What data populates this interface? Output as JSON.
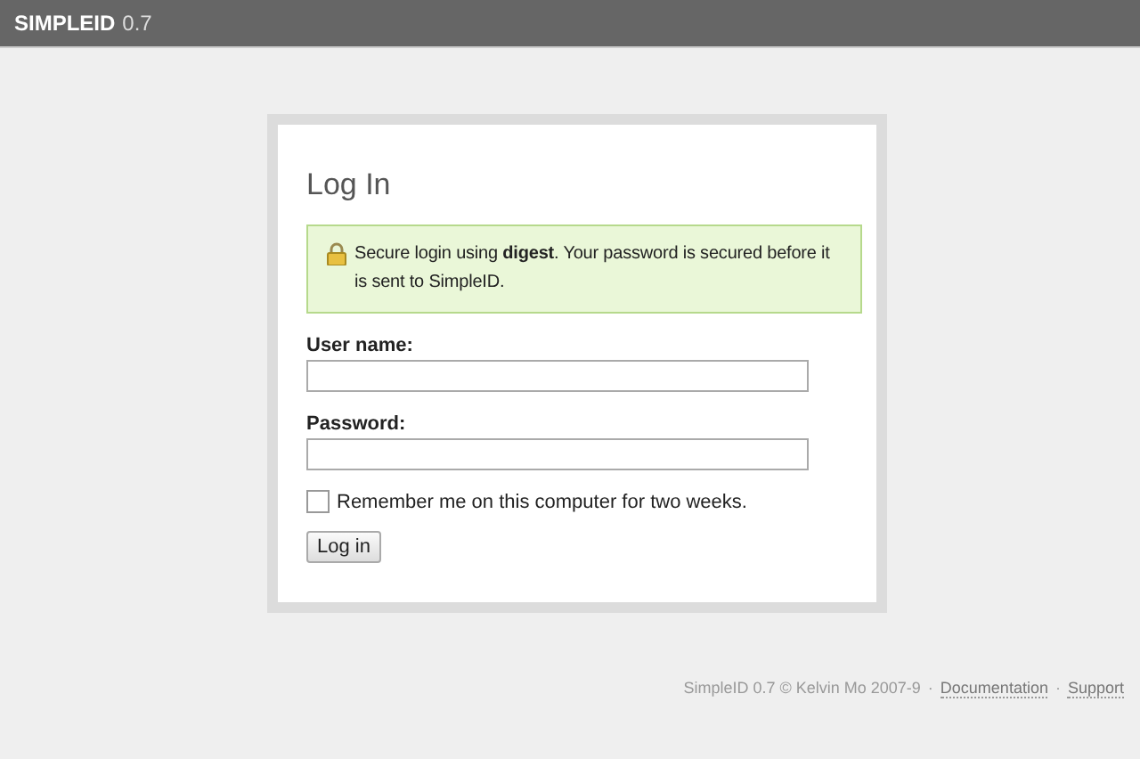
{
  "header": {
    "name": "SIMPLEID",
    "version": "0.7"
  },
  "title": "Log In",
  "notice": "Secure login using **digest**. Your password is secured before it is sent to SimpleID.",
  "fields": [
    {
      "label": "User name:"
    },
    {
      "label": "Password:"
    }
  ],
  "remember": {
    "label": "Remember me on this computer for two weeks.",
    "checked": false
  },
  "button": "Log in",
  "footer": [
    {
      "kind": "text",
      "text": "SimpleID 0.7 © Kelvin Mo 2007-9"
    },
    {
      "kind": "sep",
      "text": "·"
    },
    {
      "kind": "link",
      "text": "Documentation"
    },
    {
      "kind": "sep",
      "text": "·"
    },
    {
      "kind": "link",
      "text": "Support"
    }
  ]
}
